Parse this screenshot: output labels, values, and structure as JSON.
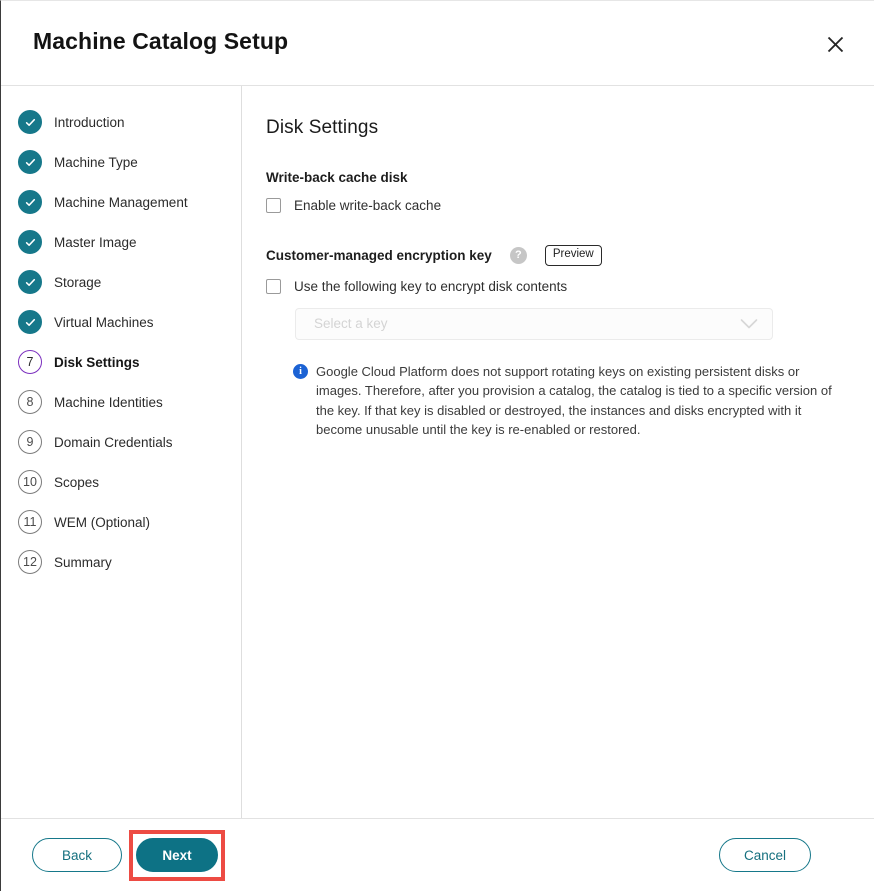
{
  "header": {
    "title": "Machine Catalog Setup",
    "close_icon": "close-icon"
  },
  "sidebar": {
    "steps": [
      {
        "num": "1",
        "label": "Introduction",
        "state": "done"
      },
      {
        "num": "2",
        "label": "Machine Type",
        "state": "done"
      },
      {
        "num": "3",
        "label": "Machine Management",
        "state": "done"
      },
      {
        "num": "4",
        "label": "Master Image",
        "state": "done"
      },
      {
        "num": "5",
        "label": "Storage",
        "state": "done"
      },
      {
        "num": "6",
        "label": "Virtual Machines",
        "state": "done"
      },
      {
        "num": "7",
        "label": "Disk Settings",
        "state": "current"
      },
      {
        "num": "8",
        "label": "Machine Identities",
        "state": "todo"
      },
      {
        "num": "9",
        "label": "Domain Credentials",
        "state": "todo"
      },
      {
        "num": "10",
        "label": "Scopes",
        "state": "todo"
      },
      {
        "num": "11",
        "label": "WEM (Optional)",
        "state": "todo"
      },
      {
        "num": "12",
        "label": "Summary",
        "state": "todo"
      }
    ]
  },
  "main": {
    "title": "Disk Settings",
    "writeback": {
      "section_label": "Write-back cache disk",
      "checkbox_label": "Enable write-back cache",
      "checked": false
    },
    "cmek": {
      "section_label": "Customer-managed encryption key",
      "help_icon": "help-icon",
      "help_glyph": "?",
      "preview_badge": "Preview",
      "checkbox_label": "Use the following key to encrypt disk contents",
      "checked": false,
      "select_placeholder": "Select a key",
      "select_value": "",
      "chevron_icon": "chevron-down-icon",
      "info_icon": "info-icon",
      "info_glyph": "i",
      "info_text": "Google Cloud Platform does not support rotating keys on existing persistent disks or images. Therefore, after you provision a catalog, the catalog is tied to a specific version of the key. If that key is disabled or destroyed, the instances and disks encrypted with it become unusable until the key is re-enabled or restored."
    }
  },
  "footer": {
    "back_label": "Back",
    "next_label": "Next",
    "cancel_label": "Cancel"
  },
  "colors": {
    "teal": "#0d7285",
    "teal_border": "#16788a",
    "purple": "#7b2fbe",
    "info_blue": "#1b62d4",
    "highlight_red": "#ed4b43"
  }
}
